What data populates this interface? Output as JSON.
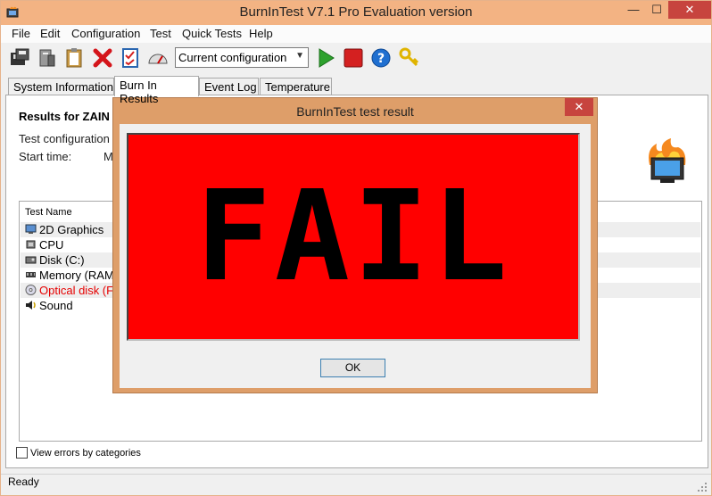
{
  "window": {
    "title": "BurnInTest V7.1 Pro Evaluation version",
    "min_glyph": "—",
    "max_glyph": "☐",
    "close_glyph": "✕"
  },
  "menu": [
    "File",
    "Edit",
    "Configuration",
    "Test",
    "Quick Tests",
    "Help"
  ],
  "toolbar": {
    "config_value": "Current configuration",
    "icons": [
      "save-icon",
      "printer-icon",
      "clipboard-icon",
      "stop-x-icon",
      "checklist-icon",
      "gauge-icon",
      "play-icon",
      "stop-icon",
      "help-icon",
      "key-icon"
    ]
  },
  "tabs": [
    "System Information",
    "Burn In Results",
    "Event Log",
    "Temperature"
  ],
  "results": {
    "title": "Results for ZAIN",
    "test_config_label": "Test configuration",
    "start_time_label": "Start time:",
    "start_time_value_partial": "M"
  },
  "list": {
    "header": "Test Name",
    "rows": [
      {
        "name": "2D Graphics",
        "icon": "monitor-icon",
        "status": "normal"
      },
      {
        "name": "CPU",
        "icon": "cpu-icon",
        "status": "normal"
      },
      {
        "name": "Disk (C:)",
        "icon": "disk-icon",
        "status": "normal"
      },
      {
        "name": "Memory (RAM)",
        "icon": "memory-icon",
        "status": "normal"
      },
      {
        "name": "Optical disk (F:)",
        "icon": "optical-disk-icon",
        "status": "fail"
      },
      {
        "name": "Sound",
        "icon": "speaker-icon",
        "status": "normal"
      }
    ]
  },
  "checkbox": {
    "label": "View errors by categories",
    "checked": false
  },
  "status": "Ready",
  "dialog": {
    "title": "BurnInTest test result",
    "close_glyph": "✕",
    "result": "FAIL",
    "ok_label": "OK"
  },
  "colors": {
    "titlebar": "#f3b383",
    "close_button": "#c7443e",
    "fail_background": "#ff0000",
    "fail_row_text": "#e60000"
  }
}
